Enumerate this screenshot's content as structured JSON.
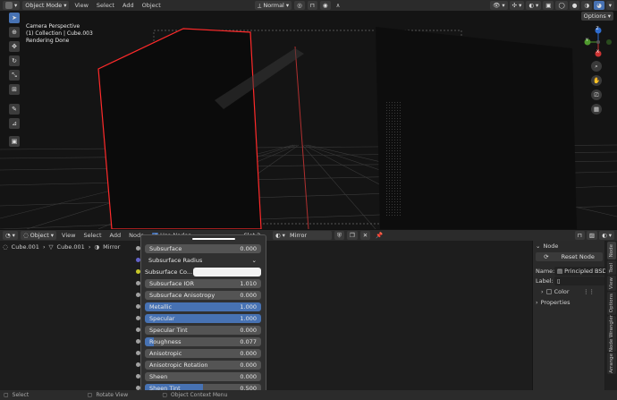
{
  "viewport_header": {
    "mode": "Object Mode",
    "menus": [
      "View",
      "Select",
      "Add",
      "Object"
    ],
    "transform": "Normal",
    "options": "Options"
  },
  "overlay": {
    "line1": "Camera Perspective",
    "line2": "(1) Collection | Cube.003",
    "line3": "Rendering Done"
  },
  "gizmo": {
    "z": "Z",
    "y": "Y",
    "x": "X"
  },
  "node_header": {
    "mode": "Object",
    "menus": [
      "View",
      "Select",
      "Add",
      "Node"
    ],
    "use_nodes": "Use Nodes",
    "slot": "Slot 2",
    "material": "Mirror"
  },
  "breadcrumb": {
    "object": "Cube.001",
    "mesh": "Cube.001",
    "material": "Mirror"
  },
  "node_rows": [
    {
      "label": "Subsurface",
      "value": "0.000",
      "style": "plain"
    },
    {
      "label": "Subsurface Radius",
      "value": "",
      "style": "dropdown"
    },
    {
      "label": "Subsurface Co...",
      "value": "",
      "style": "color"
    },
    {
      "label": "Subsurface IOR",
      "value": "1.010",
      "style": "plain"
    },
    {
      "label": "Subsurface Anisotropy",
      "value": "0.000",
      "style": "plain"
    },
    {
      "label": "Metallic",
      "value": "1.000",
      "style": "full"
    },
    {
      "label": "Specular",
      "value": "1.000",
      "style": "full"
    },
    {
      "label": "Specular Tint",
      "value": "0.000",
      "style": "plain"
    },
    {
      "label": "Roughness",
      "value": "0.077",
      "style": "partial",
      "fill": 0.077
    },
    {
      "label": "Anisotropic",
      "value": "0.000",
      "style": "plain"
    },
    {
      "label": "Anisotropic Rotation",
      "value": "0.000",
      "style": "plain"
    },
    {
      "label": "Sheen",
      "value": "0.000",
      "style": "plain"
    },
    {
      "label": "Sheen Tint",
      "value": "0.500",
      "style": "partial",
      "fill": 0.5
    }
  ],
  "sidebar": {
    "section": "Node",
    "reset": "Reset Node",
    "name_label": "Name:",
    "name_value": "Principled BSDF",
    "label_label": "Label:",
    "color": "Color",
    "properties": "Properties",
    "tabs": [
      "Node",
      "Tool",
      "View",
      "Options",
      "Node Wrangler",
      "Arrange"
    ]
  },
  "status": {
    "select": "Select",
    "rotate": "Rotate View",
    "context": "Object Context Menu"
  },
  "colors": {
    "accent": "#4772b3",
    "selection": "#ff2a2a",
    "header": "#2b2b2b"
  }
}
